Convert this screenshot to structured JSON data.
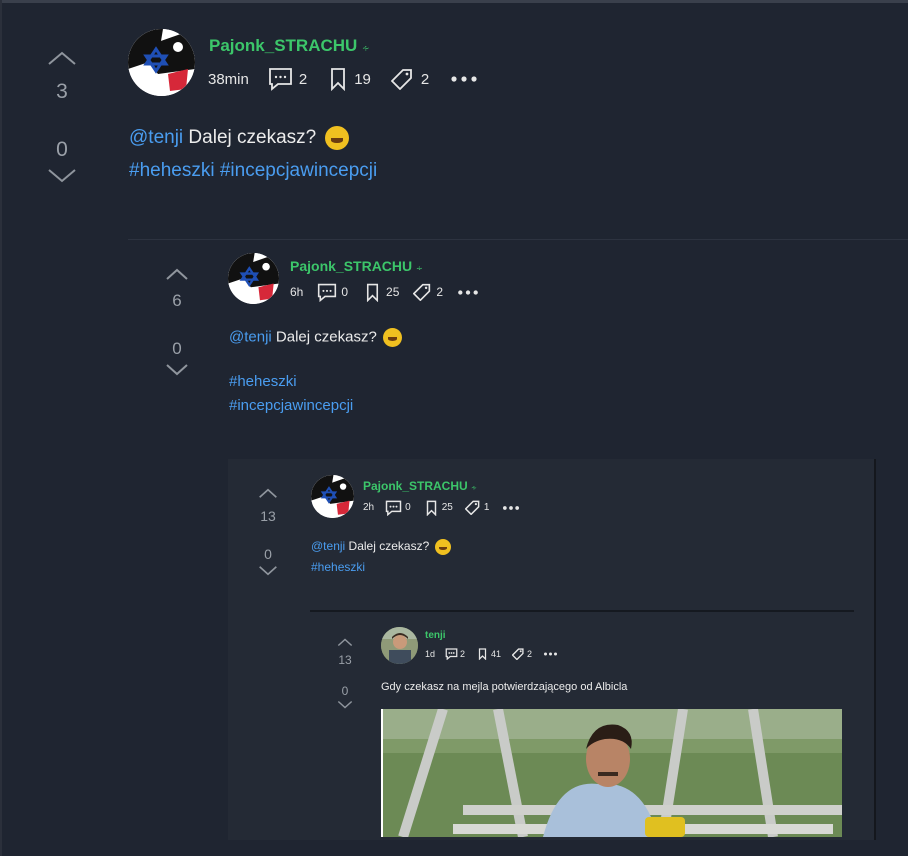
{
  "posts": [
    {
      "votes_up": "3",
      "votes_down": "0",
      "author": "Pajonk_STRACHU",
      "author_icon": "rss-icon",
      "time": "38min",
      "comments": "2",
      "bookmarks": "19",
      "tags_count": "2",
      "mention": "@tenji",
      "text": " Dalej czekasz?",
      "emoji": "rolling-on-floor-laughing-emoji",
      "hashtags": [
        "#heheszki",
        "#incepcjawincepcji"
      ]
    },
    {
      "votes_up": "6",
      "votes_down": "0",
      "author": "Pajonk_STRACHU",
      "time": "6h",
      "comments": "0",
      "bookmarks": "25",
      "tags_count": "2",
      "mention": "@tenji",
      "text": " Dalej czekasz?",
      "emoji": "rolling-on-floor-laughing-emoji",
      "hashtags": [
        "#heheszki",
        "#incepcjawincepcji"
      ]
    },
    {
      "votes_up": "13",
      "votes_down": "0",
      "author": "Pajonk_STRACHU",
      "time": "2h",
      "comments": "0",
      "bookmarks": "25",
      "tags_count": "1",
      "mention": "@tenji",
      "text": " Dalej czekasz?",
      "emoji": "rolling-on-floor-laughing-emoji",
      "hashtags": [
        "#heheszki"
      ]
    },
    {
      "votes_up": "13",
      "votes_down": "0",
      "author": "tenji",
      "time": "1d",
      "comments": "2",
      "bookmarks": "41",
      "tags_count": "2",
      "text": "Gdy czekasz na mejla potwierdzającego od Albicla",
      "image": "man-sitting-on-bench-meme-photo"
    }
  ],
  "colors": {
    "background": "#1f2531",
    "author": "#3cc66a",
    "link": "#4a9df0",
    "muted": "#9aa0a8"
  }
}
